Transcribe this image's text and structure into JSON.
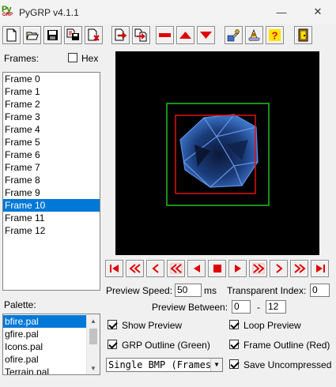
{
  "window": {
    "title": "PyGRP v4.1.1",
    "icon_text_top": "Py",
    "icon_text_bottom": "GRP",
    "minimize_glyph": "—",
    "close_glyph": "✕"
  },
  "frames": {
    "label": "Frames:",
    "hex_label": "Hex",
    "hex_checked": false,
    "items": [
      "Frame 0",
      "Frame 1",
      "Frame 2",
      "Frame 3",
      "Frame 4",
      "Frame 5",
      "Frame 6",
      "Frame 7",
      "Frame 8",
      "Frame 9",
      "Frame 10",
      "Frame 11",
      "Frame 12"
    ],
    "selected_index": 10
  },
  "palette": {
    "label": "Palette:",
    "items": [
      "bfire.pal",
      "gfire.pal",
      "Icons.pal",
      "ofire.pal",
      "Terrain.pal"
    ],
    "selected_index": 0
  },
  "playback": {
    "preview_speed_label": "Preview Speed:",
    "preview_speed_value": "50",
    "speed_unit": "ms",
    "transparent_index_label": "Transparent Index:",
    "transparent_index_value": "0",
    "preview_between_label": "Preview Between:",
    "between_start": "0",
    "between_separator": "-",
    "between_end": "12"
  },
  "options": {
    "show_preview": {
      "label": "Show Preview",
      "checked": true
    },
    "loop_preview": {
      "label": "Loop Preview",
      "checked": true
    },
    "grp_outline": {
      "label": "GRP Outline (Green)",
      "checked": true
    },
    "frame_outline": {
      "label": "Frame Outline (Red)",
      "checked": true
    },
    "save_uncompressed": {
      "label": "Save Uncompressed",
      "checked": true
    },
    "export_mode": {
      "value": "Single BMP (Framesets)"
    }
  },
  "colors": {
    "canvas_background": "#000000",
    "grp_outline": "#22c022",
    "frame_outline": "#e01010",
    "selection": "#0078d7",
    "toolbar_red": "#e00000"
  },
  "toolbar_icons": [
    "new-file-icon",
    "open-file-icon",
    "save-icon",
    "save-as-icon",
    "close-file-icon",
    "import-frame-icon",
    "insert-frame-icon",
    "remove-frame-icon",
    "move-up-icon",
    "move-down-icon",
    "settings-icon",
    "about-icon",
    "help-icon",
    "exit-icon"
  ]
}
